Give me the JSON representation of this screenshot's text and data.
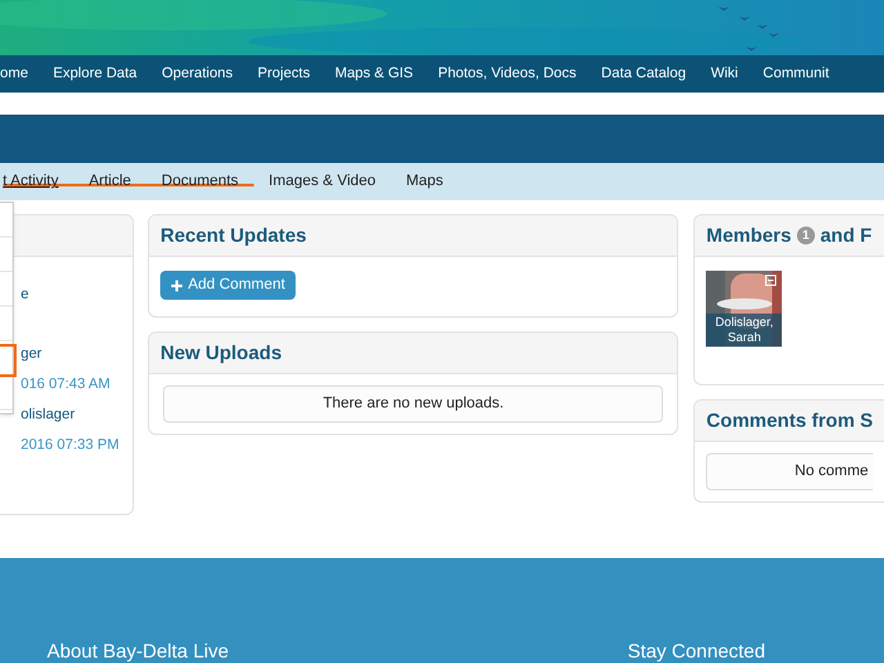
{
  "nav": [
    {
      "label": "ome"
    },
    {
      "label": "Explore Data"
    },
    {
      "label": "Operations"
    },
    {
      "label": "Projects"
    },
    {
      "label": "Maps & GIS"
    },
    {
      "label": "Photos, Videos, Docs"
    },
    {
      "label": "Data Catalog"
    },
    {
      "label": "Wiki"
    },
    {
      "label": "Communit"
    }
  ],
  "tabs": [
    {
      "label": "t Activity",
      "selected": true
    },
    {
      "label": "Article",
      "selected": false
    },
    {
      "label": "Documents",
      "selected": false
    },
    {
      "label": "Images & Video",
      "selected": false
    },
    {
      "label": "Maps",
      "selected": false
    }
  ],
  "left_panel": {
    "items": [
      {
        "kind": "text",
        "text": "e"
      },
      {
        "kind": "divider"
      },
      {
        "kind": "link",
        "text": "ger"
      },
      {
        "kind": "date",
        "text": "016 07:43 AM"
      },
      {
        "kind": "link",
        "text": "olislager"
      },
      {
        "kind": "date",
        "text": "2016 07:33 PM"
      }
    ]
  },
  "recent_updates": {
    "title": "Recent Updates",
    "button": "Add Comment"
  },
  "new_uploads": {
    "title": "New Uploads",
    "empty": "There are no new uploads."
  },
  "members": {
    "title": "Members",
    "count": "1",
    "title_rest": "and F",
    "members": [
      {
        "name": "Dolislager, Sarah"
      }
    ]
  },
  "comments": {
    "title": "Comments from S",
    "empty": "No comme"
  },
  "footer": {
    "left": "About Bay-Delta Live",
    "right": "Stay Connected"
  }
}
